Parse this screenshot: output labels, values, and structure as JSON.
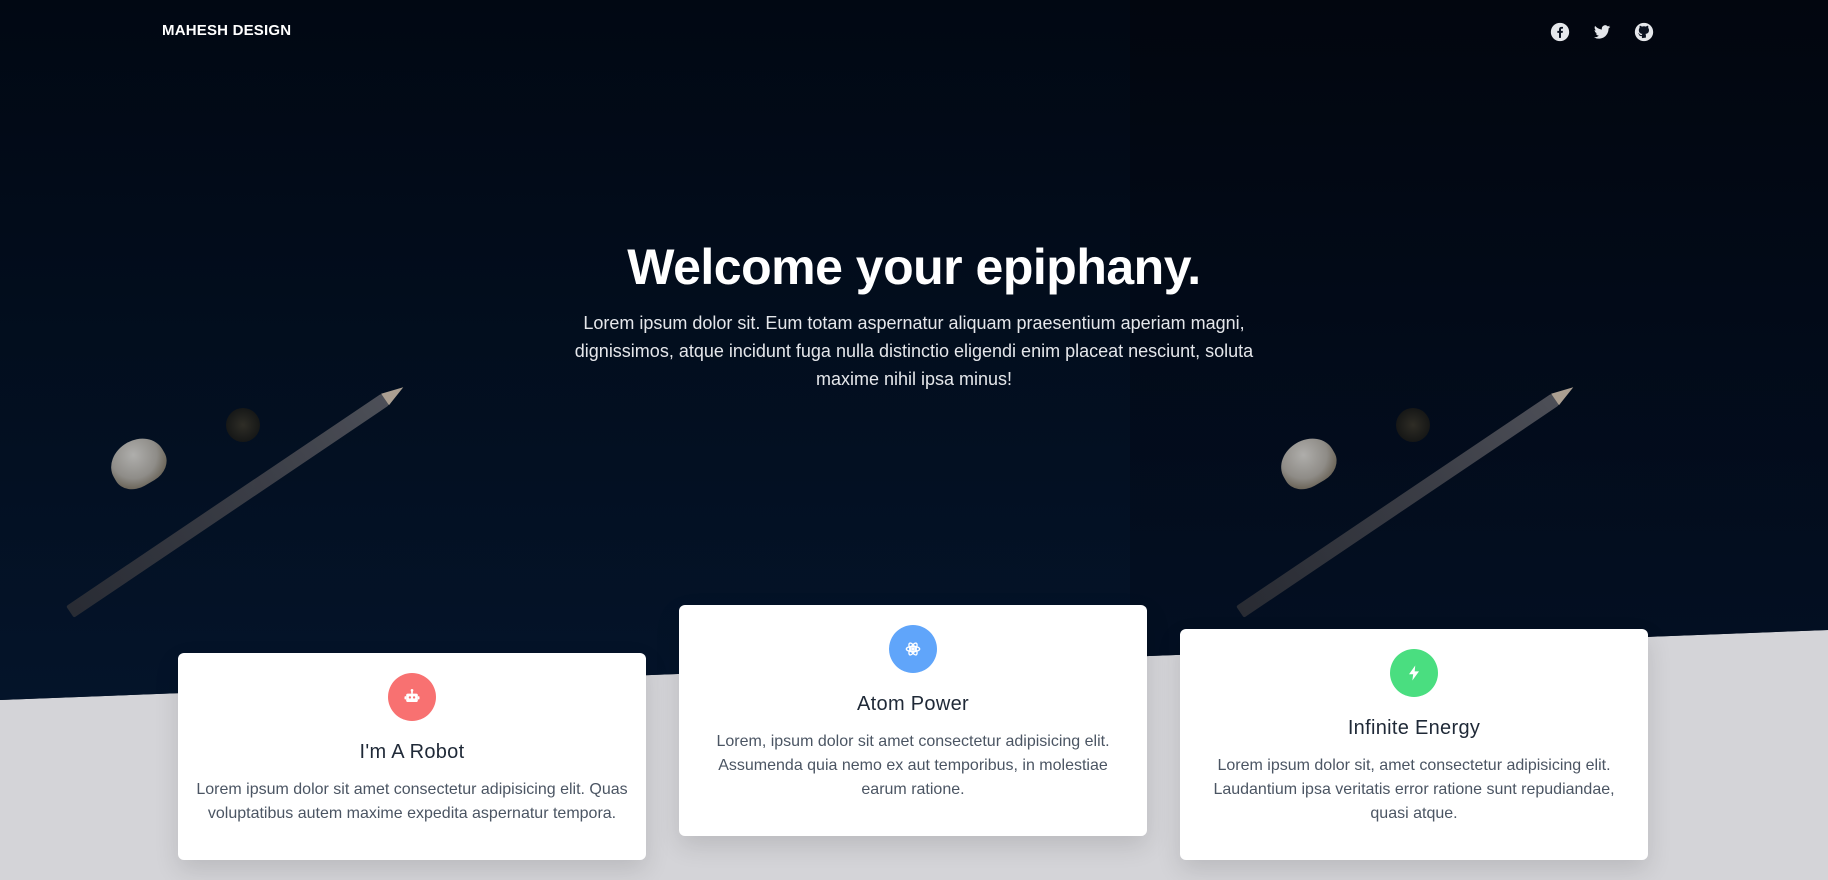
{
  "nav": {
    "brand": "MAHESH DESIGN",
    "social": [
      {
        "icon": "facebook-icon"
      },
      {
        "icon": "twitter-icon"
      },
      {
        "icon": "github-icon"
      }
    ]
  },
  "hero": {
    "title": "Welcome your epiphany.",
    "subtitle": "Lorem ipsum dolor sit. Eum totam aspernatur aliquam praesentium aperiam magni, dignissimos, atque incidunt fuga nulla distinctio eligendi enim placeat nesciunt, soluta maxime nihil ipsa minus!"
  },
  "features": [
    {
      "icon": "robot-icon",
      "color": "#f87171",
      "title": "I'm A Robot",
      "text": "Lorem ipsum dolor sit amet consectetur adipisicing elit. Quas voluptatibus autem maxime expedita aspernatur tempora."
    },
    {
      "icon": "atom-icon",
      "color": "#60a5fa",
      "title": "Atom Power",
      "text": "Lorem, ipsum dolor sit amet consectetur adipisicing elit. Assumenda quia nemo ex aut temporibus, in molestiae earum ratione."
    },
    {
      "icon": "bolt-icon",
      "color": "#4ade80",
      "title": "Infinite Energy",
      "text": "Lorem ipsum dolor sit, amet consectetur adipisicing elit. Laudantium ipsa veritatis error ratione sunt repudiandae, quasi atque."
    }
  ]
}
